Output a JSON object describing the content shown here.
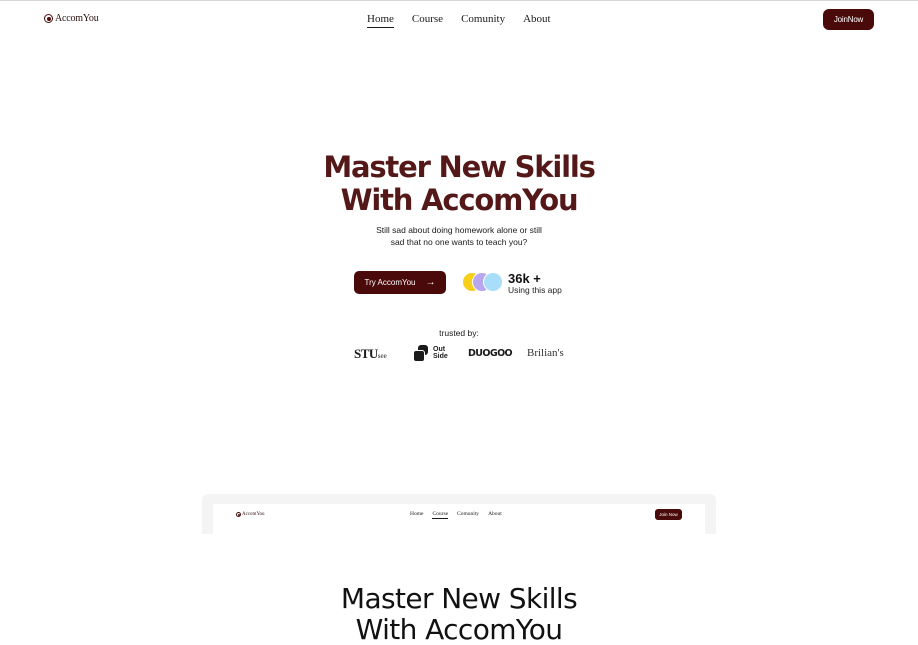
{
  "brand": {
    "name": "AccomYou"
  },
  "nav": {
    "items": [
      {
        "label": "Home",
        "active": true
      },
      {
        "label": "Course",
        "active": false
      },
      {
        "label": "Comunity",
        "active": false
      },
      {
        "label": "About",
        "active": false
      }
    ],
    "join_label": "JoinNow"
  },
  "hero": {
    "title_line1": "Master New Skills",
    "title_line2": "With AccomYou",
    "subtitle_line1": "Still sad about doing homework alone or still",
    "subtitle_line2": "sad that no one wants to teach you?",
    "cta_label": "Try AccomYou",
    "stat_value": "36k +",
    "stat_label": "Using this app",
    "trusted_label": "trusted by:",
    "logos": {
      "stu_main": "STU",
      "stu_sub": "see",
      "outside_line1": "Out",
      "outside_line2": "Side",
      "duogoo": "DUOGOO",
      "brilian": "Brilian's"
    }
  },
  "preview": {
    "brand": "AccomYou",
    "nav": [
      {
        "label": "Home",
        "active": false
      },
      {
        "label": "Course",
        "active": true
      },
      {
        "label": "Comunity",
        "active": false
      },
      {
        "label": "About",
        "active": false
      }
    ],
    "join_label": "Join Now"
  },
  "section2": {
    "title_line1": "Master New Skills",
    "title_line2": "With AccomYou"
  },
  "colors": {
    "primary": "#4a0a0a",
    "heading": "#541818",
    "avatar_yellow": "#f5cf1a",
    "avatar_purple": "#b8a6ee",
    "avatar_blue": "#a8defa"
  }
}
